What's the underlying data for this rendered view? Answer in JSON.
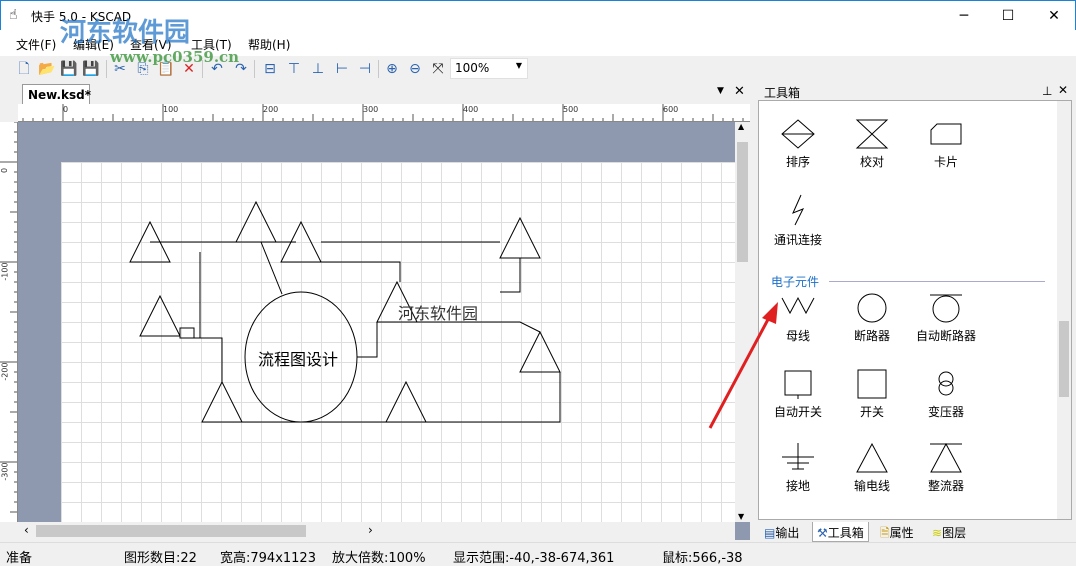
{
  "window": {
    "title": "快手 5.0 - KSCAD",
    "minimize": "─",
    "maximize": "☐",
    "close": "✕"
  },
  "watermark": {
    "text": "河东软件园",
    "url": "www.pc0359.cn"
  },
  "menu": [
    "文件(F)",
    "编辑(E)",
    "查看(V)",
    "工具(T)",
    "帮助(H)"
  ],
  "toolbar": {
    "zoom": "100%"
  },
  "document": {
    "tab": "New.ksd*"
  },
  "rulers": {
    "h": [
      "0",
      "100",
      "200",
      "300",
      "400",
      "500",
      "600"
    ],
    "v": [
      "0",
      "-100",
      "-200",
      "-300"
    ]
  },
  "canvas": {
    "texts": [
      "流程图设计",
      "河东软件园"
    ]
  },
  "panel": {
    "title": "工具箱",
    "items_top": [
      "排序",
      "校对",
      "卡片",
      "通讯连接"
    ],
    "section": "电子元件",
    "items": [
      "母线",
      "断路器",
      "自动断路器",
      "自动开关",
      "开关",
      "变压器",
      "接地",
      "输电线",
      "整流器"
    ],
    "tabs": [
      "输出",
      "工具箱",
      "属性",
      "图层"
    ]
  },
  "status": {
    "ready": "准备",
    "count": "图形数目:22",
    "size": "宽高:794x1123",
    "zoom": "放大倍数:100%",
    "range": "显示范围:-40,-38-674,361",
    "mouse": "鼠标:566,-38"
  }
}
